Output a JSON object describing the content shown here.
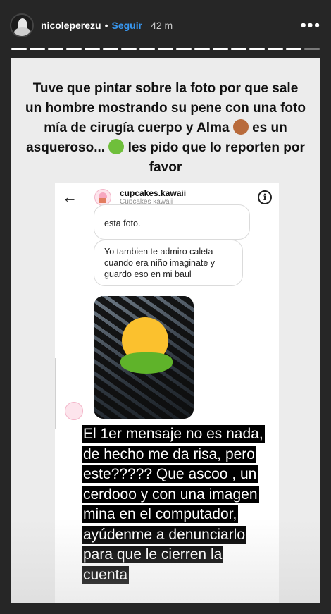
{
  "header": {
    "username": "nicoleperezu",
    "separator": "•",
    "follow_label": "Seguir",
    "time": "42 m",
    "more_icon": "more-horizontal-icon"
  },
  "progress": {
    "segments_total": 17,
    "segments_viewed": 16
  },
  "caption": {
    "part1": "Tuve que pintar sobre la foto por que sale un hombre mostrando su pene con una foto mía de cirugía cuerpo y Alma",
    "part2": "es un asqueroso...",
    "part3": "les pido que lo reporten por favor"
  },
  "dm": {
    "username": "cupcakes.kawaii",
    "subtitle": "Cupcakes kawaii",
    "bubble1": "esta foto.",
    "bubble2": "Yo tambien te admiro caleta cuando era niño imaginate y guardo eso en mi baul"
  },
  "overlay": {
    "text": "El 1er mensaje no es nada, de hecho me da risa, pero este????? Que ascoo , un cerdooo y con una imagen mina en el computador, ayúdenme a denunciarlo para que le cierren la cuenta"
  },
  "colors": {
    "background": "#262626",
    "follow": "#3897f0",
    "story_bg": "#ececec"
  }
}
